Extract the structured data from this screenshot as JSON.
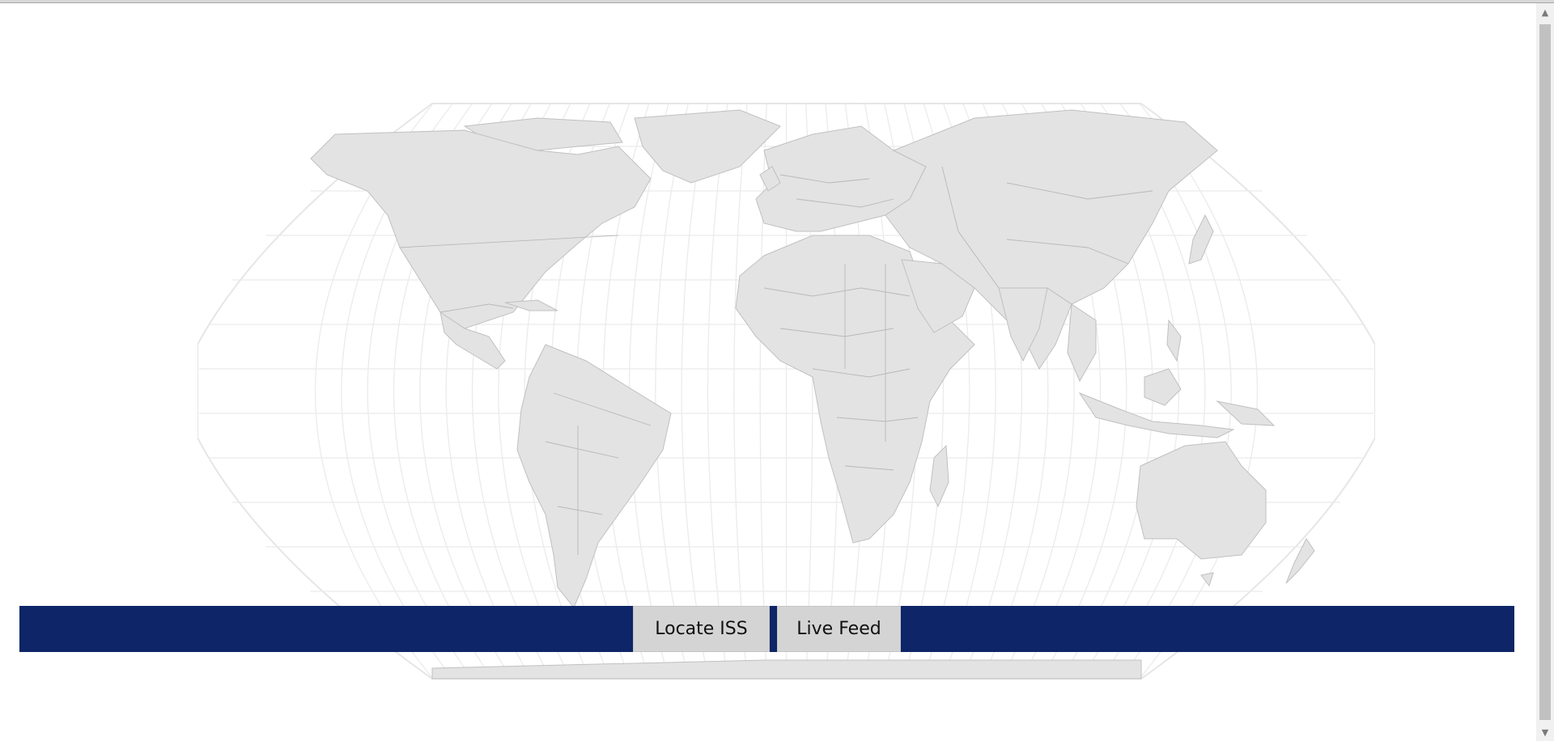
{
  "map": {
    "projection": "natural-earth",
    "land_color": "#e3e3e3",
    "border_color": "#b5b5b5",
    "graticule_color": "#ebebeb"
  },
  "controls": {
    "bar_color": "#0e2567",
    "locate_label": "Locate ISS",
    "live_label": "Live Feed"
  },
  "scrollbar": {
    "up_icon": "arrow-up-icon",
    "down_icon": "arrow-down-icon"
  }
}
